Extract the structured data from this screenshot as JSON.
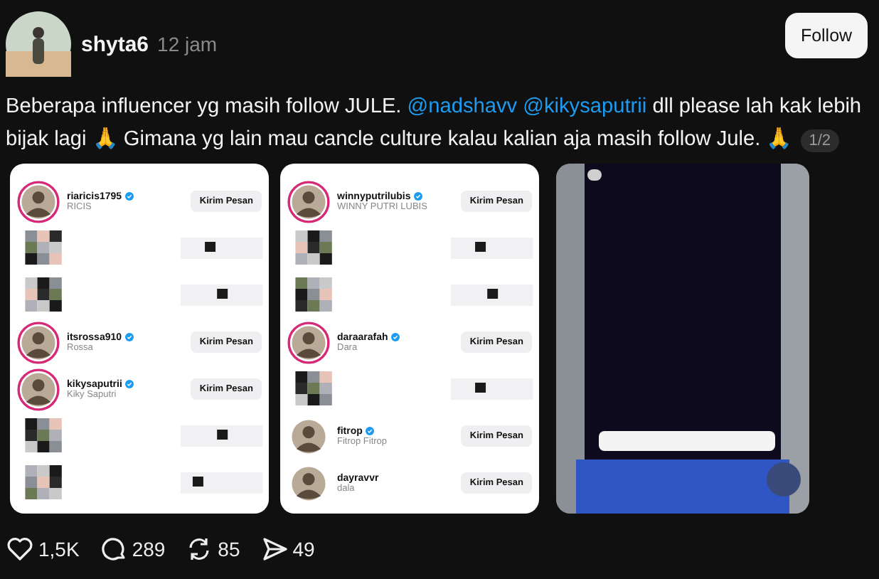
{
  "author": {
    "username": "shyta6",
    "time": "12 jam"
  },
  "follow_button": "Follow",
  "caption": [
    {
      "kind": "text",
      "text": "Beberapa influencer yg masih follow JULE. "
    },
    {
      "kind": "mention",
      "text": "@nadshavv"
    },
    {
      "kind": "mention",
      "text": "@kikysaputrii"
    },
    {
      "kind": "text",
      "text": " dll please lah kak lebih bijak lagi 🙏 Gimana yg lain mau cancle culture kalau kalian aja masih follow Jule. 🙏"
    }
  ],
  "page_counter": "1/2",
  "media": [
    {
      "kind": "list",
      "rows": [
        {
          "kind": "account",
          "username": "riaricis1795",
          "name": "RICIS",
          "verified": true,
          "story_ring": true,
          "button": "Kirim Pesan"
        },
        {
          "kind": "blurred"
        },
        {
          "kind": "blurred"
        },
        {
          "kind": "account",
          "username": "itsrossa910",
          "name": "Rossa",
          "verified": true,
          "story_ring": true,
          "button": "Kirim Pesan"
        },
        {
          "kind": "account",
          "username": "kikysaputrii",
          "name": "Kiky Saputri",
          "verified": true,
          "story_ring": true,
          "button": "Kirim Pesan"
        },
        {
          "kind": "blurred"
        },
        {
          "kind": "blurred"
        }
      ]
    },
    {
      "kind": "list",
      "rows": [
        {
          "kind": "account",
          "username": "winnyputrilubis",
          "name": "WINNY PUTRI LUBIS",
          "verified": true,
          "story_ring": true,
          "button": "Kirim Pesan"
        },
        {
          "kind": "blurred"
        },
        {
          "kind": "blurred"
        },
        {
          "kind": "account",
          "username": "daraarafah",
          "name": "Dara",
          "verified": true,
          "story_ring": true,
          "button": "Kirim Pesan"
        },
        {
          "kind": "blurred"
        },
        {
          "kind": "account",
          "username": "fitrop",
          "name": "Fitrop Fitrop",
          "verified": true,
          "story_ring": false,
          "button": "Kirim Pesan"
        },
        {
          "kind": "account",
          "username": "dayravvr",
          "name": "dala",
          "verified": false,
          "story_ring": false,
          "button": "Kirim Pesan"
        }
      ]
    },
    {
      "kind": "picture"
    }
  ],
  "actions": [
    {
      "kind": "like",
      "count": "1,5K"
    },
    {
      "kind": "reply",
      "count": "289"
    },
    {
      "kind": "repost",
      "count": "85"
    },
    {
      "kind": "share",
      "count": "49"
    }
  ]
}
